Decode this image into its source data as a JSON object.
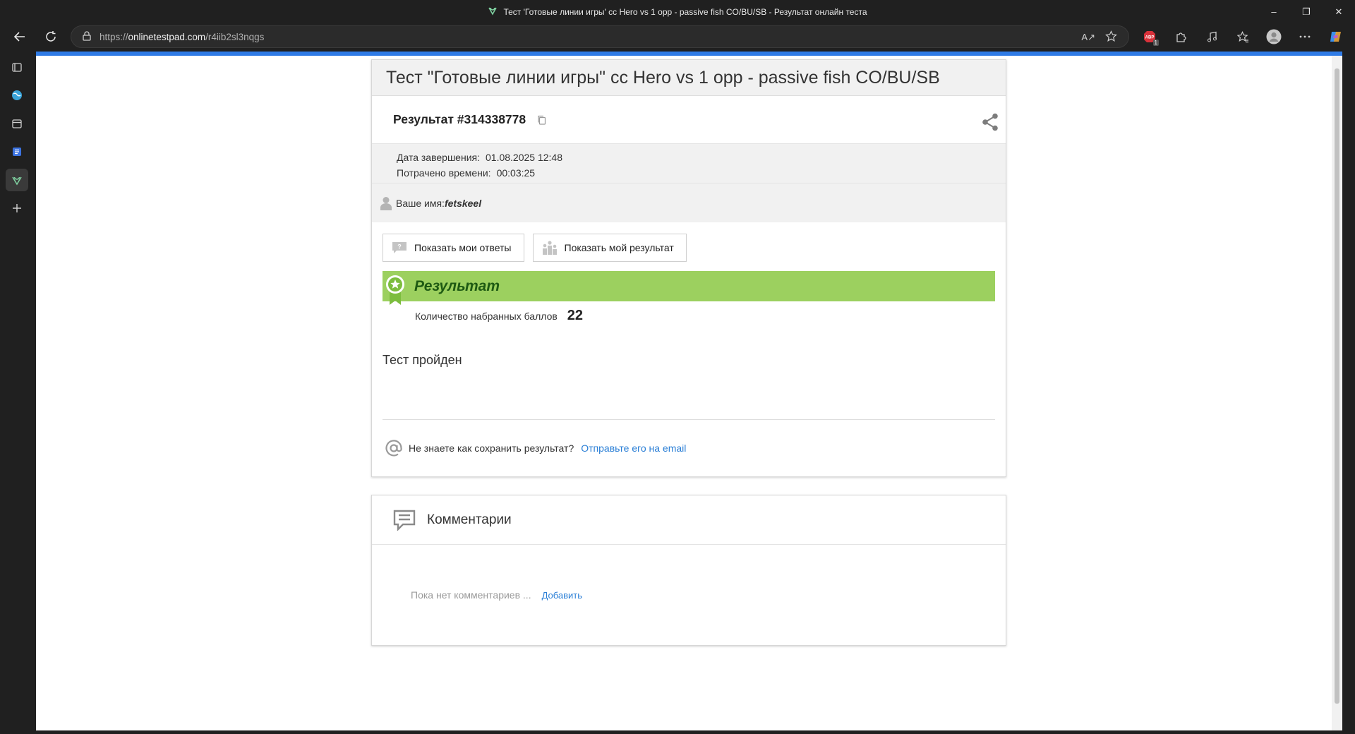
{
  "window": {
    "title": "Тест 'Готовые линии игры' cc Hero vs 1 opp - passive fish CO/BU/SB - Результат онлайн теста",
    "controls": [
      "–",
      "❐",
      "✕"
    ]
  },
  "address_bar": {
    "url_scheme": "https://",
    "url_host": "onlinetestpad.com",
    "url_path": "/r4iib2sl3nqgs",
    "read_aloud_label": "A↗",
    "extension_badge": "1"
  },
  "page": {
    "test_title": "Тест \"Готовые линии игры\" cc Hero vs 1 opp - passive fish CO/BU/SB",
    "result_label": "Результат #314338778",
    "completion_date_label": "Дата завершения:",
    "completion_date_value": "01.08.2025 12:48",
    "time_spent_label": "Потрачено времени:",
    "time_spent_value": "00:03:25",
    "name_label": "Ваше имя:",
    "name_value": "fetskeel",
    "show_answers_button": "Показать мои ответы",
    "show_result_button": "Показать мой результат",
    "result_header": "Результат",
    "score_label": "Количество набранных баллов",
    "score_value": "22",
    "status_text": "Тест пройден",
    "email_question": "Не знаете как сохранить результат?",
    "email_link": "Отправьте его на email"
  },
  "comments": {
    "title": "Комментарии",
    "empty_text": "Пока нет комментариев ...",
    "add_link": "Добавить"
  },
  "colors": {
    "result_bar": "#9cd05f",
    "result_text": "#1e5a13",
    "link": "#2b7fd6",
    "load_bar": "#2f7be6"
  }
}
